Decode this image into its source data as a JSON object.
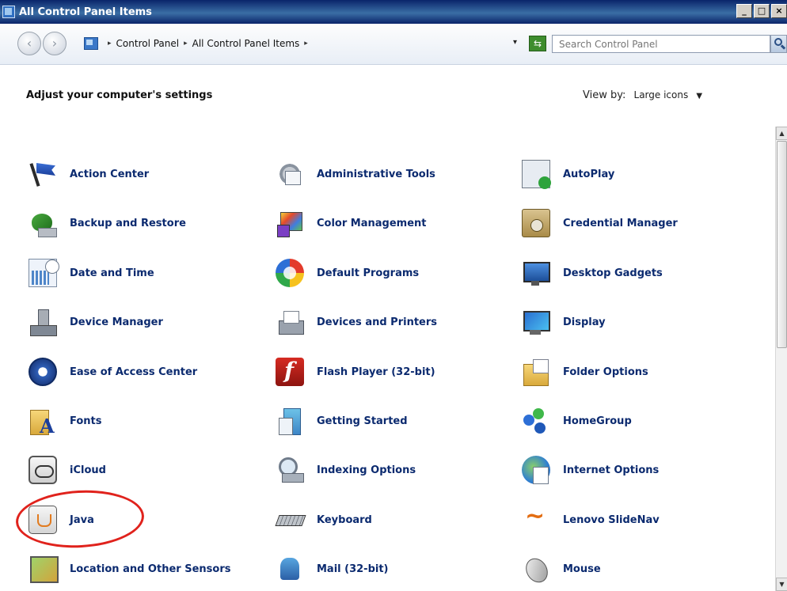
{
  "window": {
    "title": "All Control Panel Items",
    "minimize_label": "_",
    "maximize_label": "□",
    "close_label": "×"
  },
  "nav": {
    "back_icon": "‹",
    "forward_icon": "›"
  },
  "breadcrumb": {
    "items": [
      "Control Panel",
      "All Control Panel Items"
    ],
    "separator": "▸",
    "dropdown_icon": "▾"
  },
  "search": {
    "placeholder": "Search Control Panel"
  },
  "heading": "Adjust your computer's settings",
  "view_by": {
    "label": "View by:",
    "value": "Large icons",
    "caret": "▼"
  },
  "scrollbar": {
    "up": "▲",
    "down": "▼"
  },
  "items": [
    {
      "label": "Action Center",
      "icon": "flag-icon"
    },
    {
      "label": "Administrative Tools",
      "icon": "admin-tools-icon"
    },
    {
      "label": "AutoPlay",
      "icon": "autoplay-icon"
    },
    {
      "label": "Backup and Restore",
      "icon": "backup-icon"
    },
    {
      "label": "Color Management",
      "icon": "color-management-icon"
    },
    {
      "label": "Credential Manager",
      "icon": "credential-manager-icon"
    },
    {
      "label": "Date and Time",
      "icon": "calendar-clock-icon"
    },
    {
      "label": "Default Programs",
      "icon": "default-programs-icon"
    },
    {
      "label": "Desktop Gadgets",
      "icon": "desktop-gadgets-icon"
    },
    {
      "label": "Device Manager",
      "icon": "device-manager-icon"
    },
    {
      "label": "Devices and Printers",
      "icon": "printer-icon"
    },
    {
      "label": "Display",
      "icon": "display-icon"
    },
    {
      "label": "Ease of Access Center",
      "icon": "ease-of-access-icon"
    },
    {
      "label": "Flash Player (32-bit)",
      "icon": "flash-icon"
    },
    {
      "label": "Folder Options",
      "icon": "folder-options-icon"
    },
    {
      "label": "Fonts",
      "icon": "fonts-icon"
    },
    {
      "label": "Getting Started",
      "icon": "getting-started-icon"
    },
    {
      "label": "HomeGroup",
      "icon": "homegroup-icon"
    },
    {
      "label": "iCloud",
      "icon": "icloud-icon"
    },
    {
      "label": "Indexing Options",
      "icon": "indexing-options-icon"
    },
    {
      "label": "Internet Options",
      "icon": "internet-options-icon"
    },
    {
      "label": "Java",
      "icon": "java-icon"
    },
    {
      "label": "Keyboard",
      "icon": "keyboard-icon"
    },
    {
      "label": "Lenovo SlideNav",
      "icon": "lenovo-slidenav-icon"
    },
    {
      "label": "Location and Other Sensors",
      "icon": "location-sensors-icon"
    },
    {
      "label": "Mail (32-bit)",
      "icon": "mail-icon"
    },
    {
      "label": "Mouse",
      "icon": "mouse-icon"
    }
  ],
  "colors": {
    "link": "#0b2a6f",
    "annotation": "#e0221c",
    "titlebar": "#0a246a"
  }
}
